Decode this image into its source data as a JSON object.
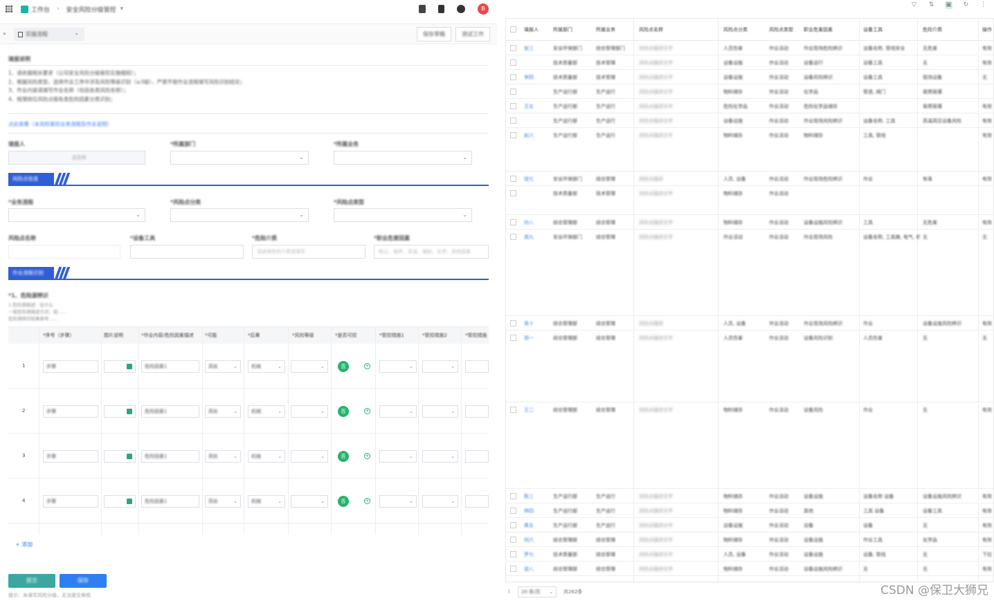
{
  "left": {
    "topbar": {
      "workspace": "工作台",
      "page": "安全风险分级管控",
      "avatar": "B"
    },
    "subbar": {
      "dropdown": "实操流程",
      "btn1": "保存草稿",
      "btn2": "测试工作"
    },
    "instructions": {
      "title": "填报说明",
      "lines": [
        "1、请依据相关要求（公司安全风险分级管控实施细则）；",
        "2、根据风险类型，选择作业工序中涉及风险等级识别（≥3级），严禁不按作业流程填写风险识别结论；",
        "3、作业内容请填写作业名称（包括各类风险名称）；",
        "4、梳理岗位风险点按各类危险因素分类识别；"
      ],
      "link": "点此查看（本风险管控业务流程及作业说明）"
    },
    "form": {
      "fields_row1": {
        "a": "填报人",
        "b": "*所属部门",
        "c": "*所属业务",
        "a_placeholder": "请选择"
      },
      "section1": "风险点信息",
      "fields_row2": {
        "a": "*业务流程",
        "b": "*风险点分类",
        "c": "*风险点类型"
      },
      "fields_row3": {
        "a": "风险点名称",
        "b": "*设备工具",
        "c": "*危险介质",
        "d": "*职业危害因素"
      },
      "row3_placeholders": {
        "b": "请选择设备工具",
        "c": "请选择危险介质或填写",
        "d": "粉尘、噪声、高温、辐射、化学、其他因素"
      },
      "section2": "作业流程识别",
      "subheading": "*1、危险源辨识",
      "sub_notes": [
        "1.危险源描述：在什么",
        "一般危险源描述方式：如……",
        "危险源辨识结果参考……"
      ]
    },
    "table": {
      "headers": [
        "*序号（步骤）",
        "图片说明",
        "*作业内容/危险因素描述",
        "*可能",
        "*后果",
        "*风险等级",
        "*是否可控",
        "*管控措施1",
        "*管控措施2",
        "*管控措施"
      ],
      "rows": [
        {
          "num": "1",
          "content": "危险因素1",
          "a": "高处",
          "b": "机械",
          "badge": "否"
        },
        {
          "num": "2",
          "content": "危险因素1",
          "a": "高处",
          "b": "机械",
          "badge": "否"
        },
        {
          "num": "3",
          "content": "危险因素1",
          "a": "高处",
          "b": "机械",
          "badge": "否"
        },
        {
          "num": "4",
          "content": "危险因素1",
          "a": "高处",
          "b": "机械",
          "badge": "否"
        }
      ],
      "add_row": "+ 添加"
    },
    "buttons": {
      "submit": "提交",
      "save": "保存"
    },
    "footer_note": "提示：未填写风险分级，无法提交审核"
  },
  "right": {
    "headers": [
      "填报人",
      "所属部门",
      "所属业务",
      "风险点名称",
      "风险点分类",
      "风险点类型",
      "职业危害因素",
      "设备工具",
      "危险介质",
      "操作"
    ],
    "rows": [
      [
        "张三",
        "安全环保部门",
        "综合管理部门",
        "风险点描述文字",
        "人员伤害",
        "作业活动",
        "作业现场危险辨识",
        "设备名称, 管线安全",
        "无危害",
        "有效"
      ],
      [
        "",
        "技术质量部",
        "技术管理",
        "风险点描述文字",
        "设备设施",
        "作业活动",
        "设备运行",
        "设备工具",
        "无",
        "有效"
      ],
      [
        "李四",
        "技术质量部",
        "技术管理",
        "风险点描述文字",
        "设备设施",
        "作业活动",
        "设备风险辨识",
        "设备工具",
        "现场设备",
        "无"
      ],
      [
        "",
        "生产运行部",
        "生产运行",
        "风险点描述文字",
        "物料储存",
        "作业活动",
        "化学品",
        "管道, 阀门",
        "易燃易爆",
        ""
      ],
      [
        "王五",
        "生产运行部",
        "生产运行",
        "风险点描述文字",
        "危险化学品",
        "作业活动",
        "危险化学品储存",
        "",
        "易燃易爆",
        "有效"
      ],
      [
        "",
        "生产运行部",
        "生产运行",
        "风险点描述文字",
        "设备设施",
        "作业活动",
        "作业现场风险辨识",
        "设备名称, 工具",
        "高温高压设备风险",
        "有效"
      ],
      [
        "赵六",
        "生产运行部",
        "生产运行",
        "风险点描述文字",
        "物料储存",
        "作业活动",
        "物料储存",
        "工具, 管线",
        "",
        "有效"
      ],
      [
        "钱七",
        "安全环保部门",
        "综合管理",
        "风险点描述",
        "人员, 设备",
        "作业活动",
        "作业现场危险辨识",
        "作业",
        "有毒",
        "有效"
      ],
      [
        "",
        "技术质量部",
        "技术管理",
        "风险点描述文字",
        "物料储存",
        "作业活动",
        "",
        "",
        "",
        ""
      ],
      [
        "孙八",
        "综合管理部",
        "综合管理",
        "风险点描述文字",
        "物料储存",
        "作业活动",
        "设备设施风险辨识",
        "工具",
        "无危害",
        "有效"
      ],
      [
        "周九",
        "安全环保部门",
        "综合管理",
        "风险点描述文字",
        "作业活动",
        "作业活动",
        "作业现场风险",
        "设备名称, 工具箱, 电气, 机械, 管道",
        "无",
        "无"
      ],
      [
        "吴十",
        "综合管理部",
        "综合管理",
        "风险点描述",
        "人员, 设备",
        "作业活动",
        "作业现场风险辨识",
        "作业",
        "设备设施风险辨识",
        "有效"
      ],
      [
        "郑一",
        "综合管理部",
        "综合管理",
        "风险点描述文字",
        "人员伤害",
        "作业活动",
        "设备风险识别",
        "人员伤害",
        "无",
        "无"
      ],
      [
        "王二",
        "综合管理部",
        "综合管理",
        "风险点描述文字",
        "物料储存",
        "作业活动",
        "设备风险",
        "作业",
        "无",
        "有效"
      ],
      [
        "陈三",
        "生产运行部",
        "生产运行",
        "风险点描述文字",
        "物料储存",
        "作业活动",
        "设备设施",
        "设备名称 设备",
        "设备设施风险辨识",
        "有效"
      ],
      [
        "林四",
        "生产运行部",
        "生产运行",
        "风险点描述文字",
        "物料储存",
        "作业活动",
        "其他",
        "工具 设备",
        "设备工具",
        "有效"
      ],
      [
        "黄五",
        "生产运行部",
        "生产运行",
        "风险点描述文字",
        "设备设施",
        "作业活动",
        "设备",
        "设备",
        "无",
        "有效"
      ],
      [
        "何六",
        "综合管理部",
        "综合管理",
        "风险点描述文字",
        "物料储存",
        "作业活动",
        "设备设施",
        "作业工具",
        "化学品",
        "有效"
      ],
      [
        "罗七",
        "技术质量部",
        "综合管理",
        "风险点描述文字",
        "人员, 设备",
        "作业活动",
        "设备设施",
        "设备, 管线",
        "无",
        "下拉"
      ],
      [
        "梁八",
        "综合管理部",
        "综合管理",
        "风险点描述文字",
        "物料储存",
        "作业活动",
        "设备设施风险辨识",
        "无",
        "无",
        "有效"
      ]
    ],
    "pager": {
      "page_size": "20 条/页",
      "total": "共262条"
    }
  },
  "watermark": "CSDN @保卫大狮兄",
  "colors": {
    "primary": "#2f5fd6",
    "link": "#3a7be8",
    "green": "#27b36b",
    "teal": "#1bb5a3",
    "avatar": "#e64b4b"
  }
}
